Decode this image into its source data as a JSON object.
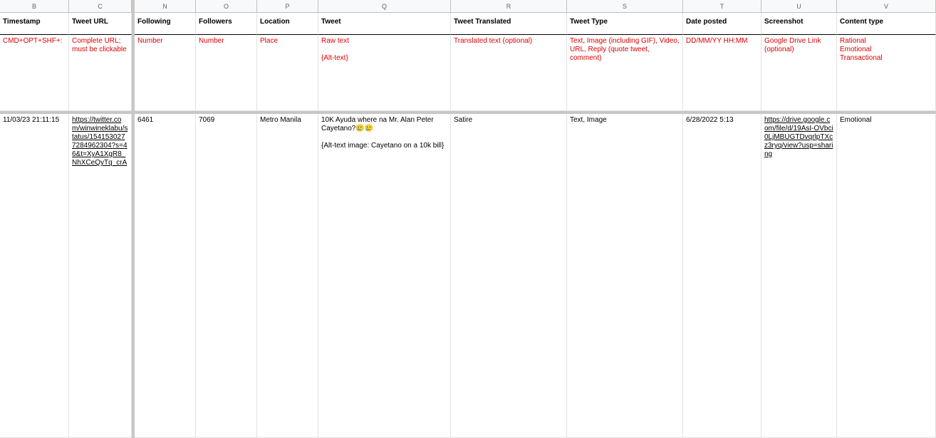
{
  "columns": [
    "B",
    "C",
    "N",
    "O",
    "P",
    "Q",
    "R",
    "S",
    "T",
    "U",
    "V"
  ],
  "header": {
    "timestamp": "Timestamp",
    "tweet_url": "Tweet URL",
    "following": "Following",
    "followers": "Followers",
    "location": "Location",
    "tweet": "Tweet",
    "tweet_translated": "Tweet Translated",
    "tweet_type": "Tweet Type",
    "date_posted": "Date posted",
    "screenshot": "Screenshot",
    "content_type": "Content type"
  },
  "guide": {
    "timestamp": "CMD+OPT+SHF+:",
    "tweet_url": "Complete URL; must be clickable",
    "following": "Number",
    "followers": "Number",
    "location": "Place",
    "tweet": "Raw text\n\n{Alt-text}",
    "tweet_translated": "Translated text (optional)",
    "tweet_type": "Text, Image (including GIF), Video, URL, Reply (quote tweet, comment)",
    "date_posted": "DD/MM/YY HH:MM",
    "screenshot": "Google Drive Link (optional)",
    "content_type": "Rational\nEmotional\nTransactional"
  },
  "row": {
    "timestamp": "11/03/23 21:11:15",
    "tweet_url": "https://twitter.com/winwineklabu/status/1541530277284962304?s=46&t=XyA1XgR8_NhXCeQyTq_crA",
    "following": "6461",
    "followers": "7069",
    "location": "Metro Manila",
    "tweet": "10K Ayuda where na Mr. Alan Peter Cayetano?🥲🥲\n\n{Alt-text image: Cayetano on a 10k bill}",
    "tweet_translated": "Satire",
    "tweet_type": "Text, Image",
    "date_posted": "6/28/2022 5:13",
    "screenshot": "https://drive.google.com/file/d/19AsI-OVbci0LjMBUGTDvqrlpTXcz3ryq/view?usp=sharing",
    "content_type": "Emotional"
  },
  "colors": {
    "guide_text": "#e00000",
    "freeze_bar": "#c7c7c7"
  }
}
